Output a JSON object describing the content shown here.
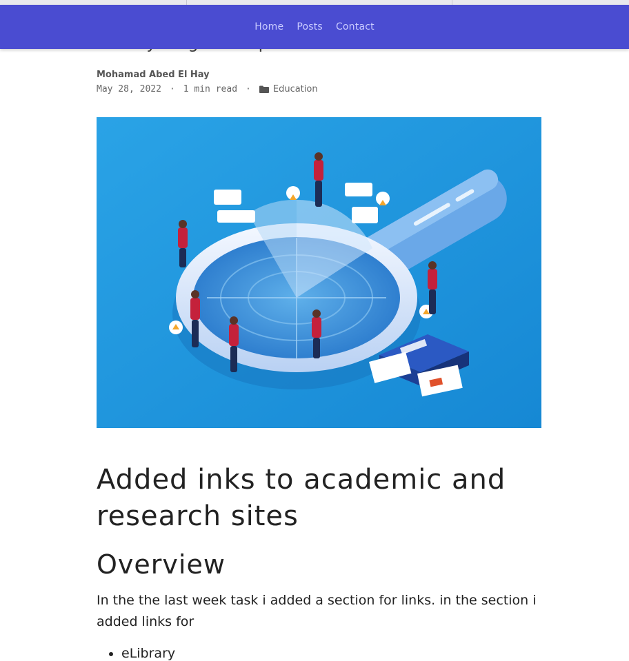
{
  "nav": {
    "items": [
      {
        "label": "Home"
      },
      {
        "label": "Posts"
      },
      {
        "label": "Contact"
      }
    ]
  },
  "post": {
    "partial_title": "Weekly Progress Report",
    "author": "Mohamad Abed El Hay",
    "date": "May 28, 2022",
    "read_time": "1 min read",
    "separator": "·",
    "category": "Education",
    "category_icon": "folder-icon",
    "hero_image": "analytics-magnifier-illustration"
  },
  "content": {
    "heading1": "Added inks to academic and research sites",
    "heading2": "Overview",
    "paragraph": "In the the last week task i added a section for links. in the section i added links for",
    "list_items": [
      "eLibrary"
    ]
  },
  "colors": {
    "navbar": "#4a4cd1",
    "nav_text": "#c9cbff",
    "hero_bg": "#1f9be0"
  }
}
